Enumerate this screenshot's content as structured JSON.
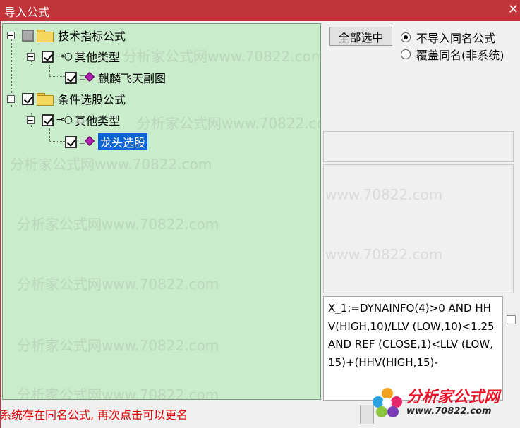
{
  "window": {
    "title": "导入公式",
    "close_glyph": "✕"
  },
  "tree": {
    "nodes": [
      {
        "label": "技术指标公式",
        "level": 0,
        "icon": "folder-icon",
        "check": "partial",
        "expander": true
      },
      {
        "label": "其他类型",
        "level": 1,
        "icon": "key-icon",
        "check": "checked",
        "expander": true
      },
      {
        "label": "麒麟飞天副图",
        "level": 2,
        "icon": "gem-icon",
        "check": "checked",
        "expander": false
      },
      {
        "label": "条件选股公式",
        "level": 0,
        "icon": "folder-icon",
        "check": "checked",
        "expander": true
      },
      {
        "label": "其他类型",
        "level": 1,
        "icon": "key-icon",
        "check": "checked",
        "expander": true
      },
      {
        "label": "龙头选股",
        "level": 2,
        "icon": "gem-icon",
        "check": "checked",
        "expander": false,
        "selected": true
      }
    ]
  },
  "controls": {
    "select_all_label": "全部选中",
    "radio_no_import": "不导入同名公式",
    "radio_overwrite": "覆盖同名(非系统)",
    "selected_radio": "no_import"
  },
  "formula": {
    "text": "X_1:=DYNAINFO(4)>0 AND HHV(HIGH,10)/LLV (LOW,10)<1.25 AND REF (CLOSE,1)<LLV (LOW,15)+(HHV(HIGH,15)-"
  },
  "status": {
    "message": "系统存在同名公式, 再次点击可以更名"
  },
  "logo": {
    "main_text": "分析家公式网",
    "sub_text": "www.70822.com"
  },
  "watermark": {
    "text": "分析家公式网www.70822.com"
  },
  "colors": {
    "titlebar": "#c0343a",
    "tree_bg": "#c9ecca",
    "selection": "#0a64d6",
    "status_text": "#e00000"
  }
}
